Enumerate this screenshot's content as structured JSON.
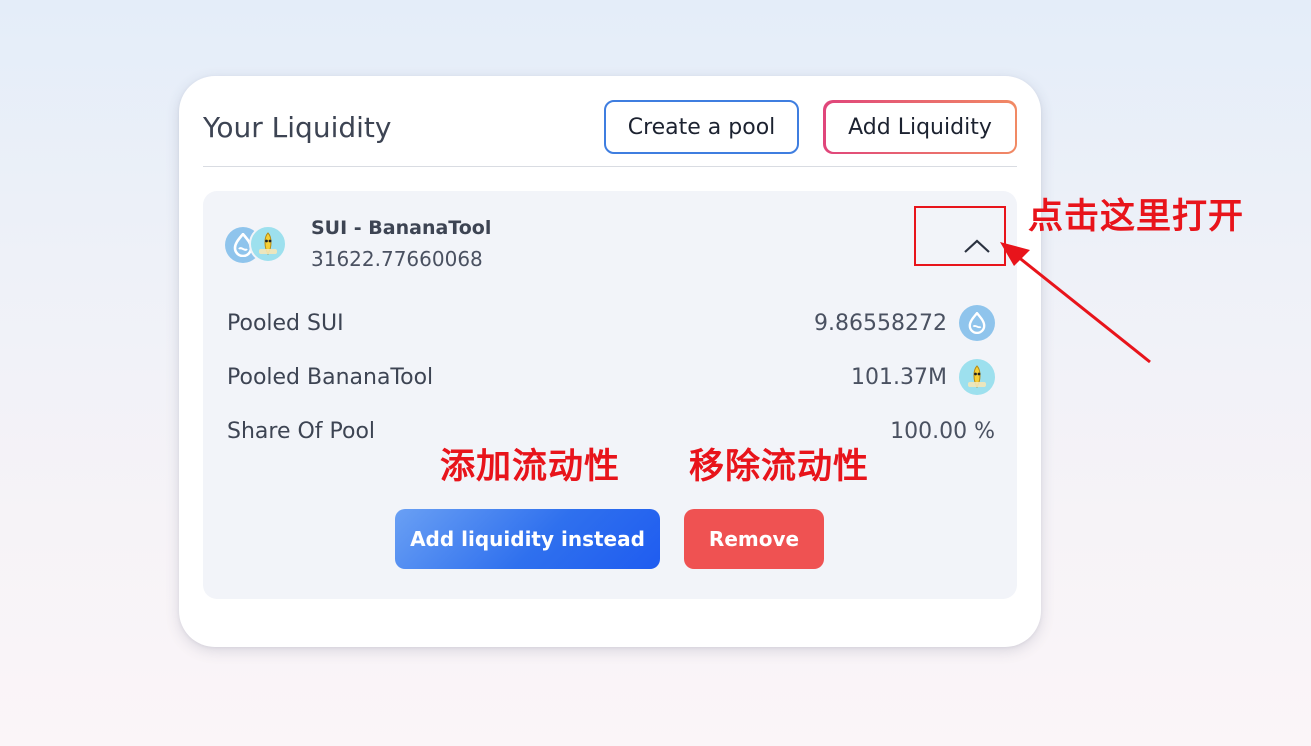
{
  "card": {
    "title": "Your Liquidity",
    "create_pool_label": "Create a pool",
    "add_liquidity_label": "Add Liquidity"
  },
  "position": {
    "pair_name": "SUI - BananaTool",
    "lp_amount": "31622.77660068",
    "token_a_icon": "sui-icon",
    "token_b_icon": "bananatool-icon",
    "expanded": true,
    "rows": [
      {
        "label": "Pooled SUI",
        "value": "9.86558272",
        "icon": "sui-icon"
      },
      {
        "label": "Pooled BananaTool",
        "value": "101.37M",
        "icon": "bananatool-icon"
      },
      {
        "label": "Share Of Pool",
        "value": "100.00 %"
      }
    ],
    "add_instead_label": "Add liquidity instead",
    "remove_label": "Remove"
  },
  "annotations": {
    "open_hint": "点击这里打开",
    "add_hint": "添加流动性",
    "remove_hint": "移除流动性"
  },
  "colors": {
    "primary_blue": "#2f70ee",
    "remove_red": "#ef5252",
    "annotation_red": "#e8141b",
    "create_border": "#3f7ee0",
    "add_border_start": "#e0457b",
    "add_border_end": "#f18a64"
  }
}
